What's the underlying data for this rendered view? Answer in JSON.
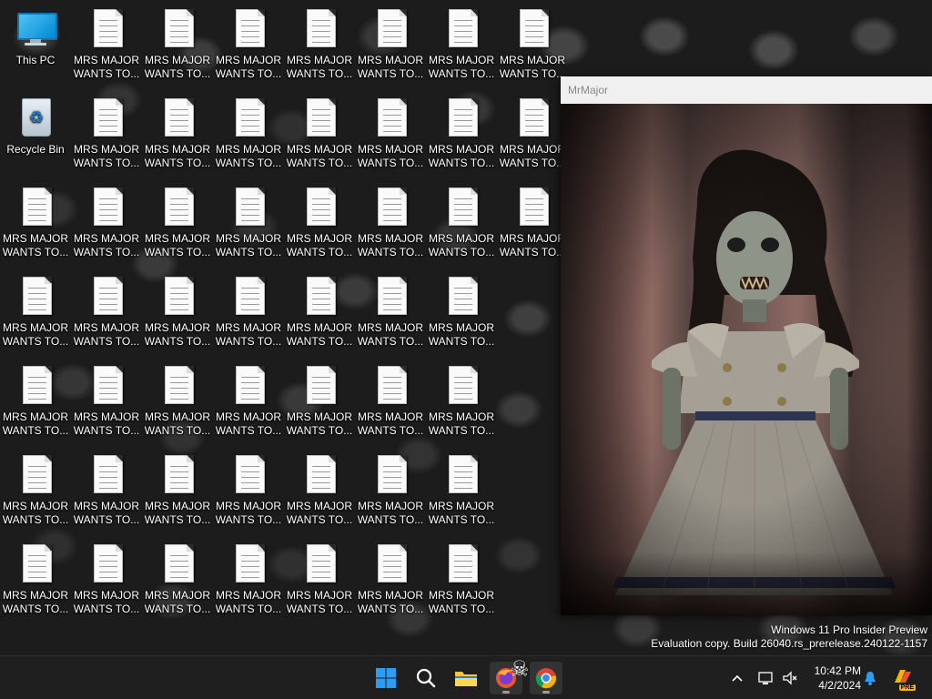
{
  "desktop": {
    "this_pc_label": "This PC",
    "recycle_bin_label": "Recycle Bin",
    "file_label_line1": "MRS MAJOR",
    "file_label_line2": "WANTS TO..."
  },
  "window": {
    "title": "MrMajor"
  },
  "watermark": {
    "line1": "Windows 11 Pro Insider Preview",
    "line2": "Evaluation copy. Build 26040.rs_prerelease.240122-1157"
  },
  "taskbar": {
    "time": "10:42 PM",
    "date": "4/2/2024",
    "copilot_badge": "PRE",
    "pinned": [
      "start-icon",
      "search-icon",
      "file-explorer-icon",
      "firefox-icon",
      "chrome-icon"
    ]
  },
  "colors": {
    "taskbar": "#1f1f1f",
    "window_title_bg": "#f0f0f0",
    "start_blue": "#1e90ff"
  }
}
